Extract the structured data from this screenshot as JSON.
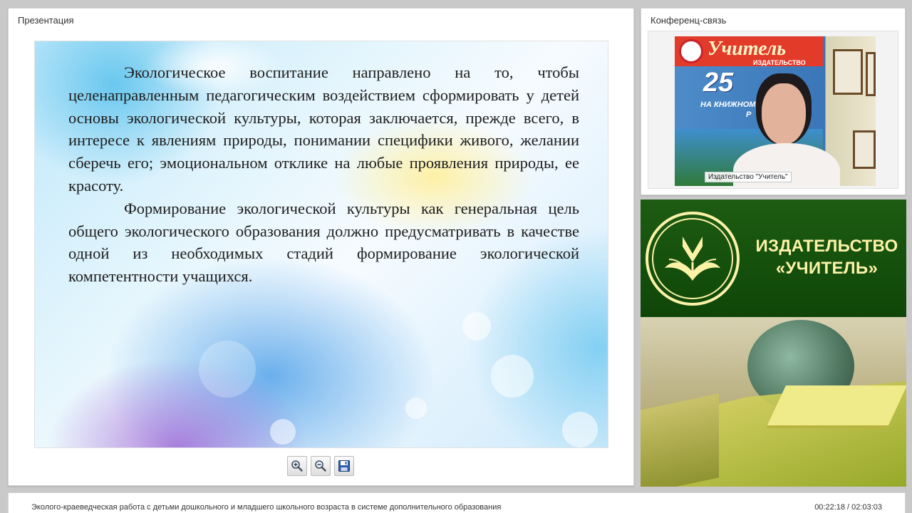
{
  "presentation_panel": {
    "title": "Презентация",
    "slide": {
      "paragraphs": [
        "Экологическое воспитание направлено на то, чтобы целенаправленным педагогическим воздействием сформировать у детей основы экологической культуры, которая заключается, прежде всего, в интересе к явлениям природы, понимании специфики живого, желании сберечь его; эмоциональном отклике на любые проявления природы, ее красоту.",
        "Формирование экологической культуры как генеральная цель общего экологического образования должно предусматривать в качестве одной из необходимых стадий формирование экологической компетентности учащихся."
      ]
    },
    "toolbar": {
      "zoom_in_icon": "zoom-in-icon",
      "zoom_out_icon": "zoom-out-icon",
      "save_icon": "save-icon"
    }
  },
  "conference_panel": {
    "title": "Конференц-связь",
    "video_label": "Издательство \"Учитель\"",
    "poster": {
      "brand": "Учитель",
      "line1": "ИЗДАТЕЛЬСТВО",
      "number": "25",
      "line2": "НА КНИЖНОМ",
      "line3": "Р"
    }
  },
  "banner": {
    "line1": "ИЗДАТЕЛЬСТВО",
    "line2": "«УЧИТЕЛЬ»",
    "accent_color": "#fbf2a8",
    "background_color": "#1d5c12"
  },
  "status_bar": {
    "title": "Эколого-краеведческая работа с детьми дошкольного и младшего школьного возраста в системе дополнительного образования",
    "time": "00:22:18 / 02:03:03"
  }
}
